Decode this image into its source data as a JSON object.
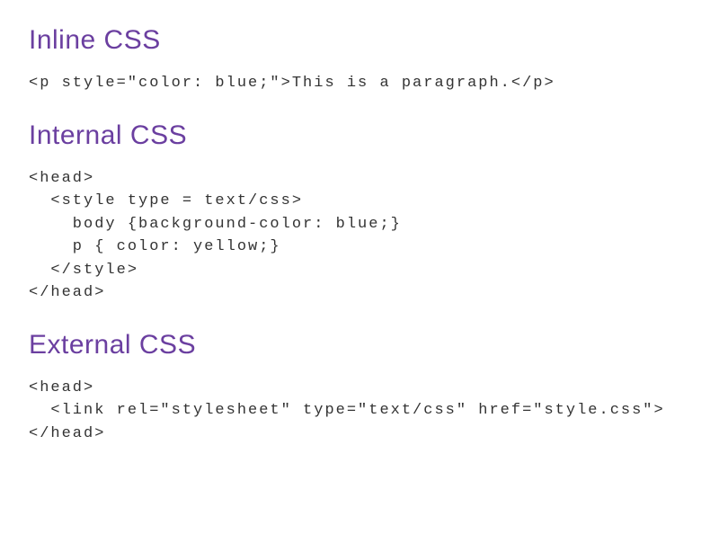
{
  "sections": {
    "inline": {
      "heading": "Inline CSS",
      "code": "<p style=\"color: blue;\">This is a paragraph.</p>"
    },
    "internal": {
      "heading": "Internal CSS",
      "code": "<head>\n  <style type = text/css>\n    body {background-color: blue;}\n    p { color: yellow;}\n  </style>\n</head>"
    },
    "external": {
      "heading": "External CSS",
      "code": "<head>\n  <link rel=\"stylesheet\" type=\"text/css\" href=\"style.css\">\n</head>"
    }
  }
}
